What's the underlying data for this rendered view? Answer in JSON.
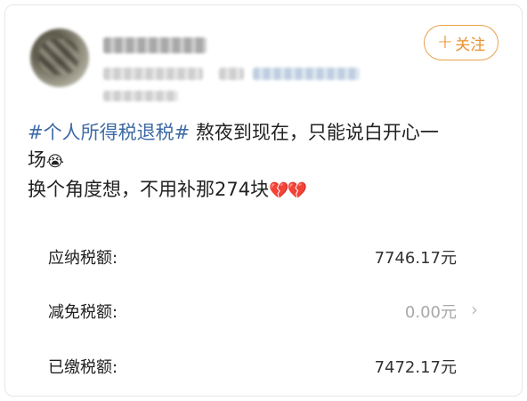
{
  "post": {
    "follow_label": "关注",
    "topic": "#个人所得税退税#",
    "text_line1": " 熬夜到现在，只能说白开心一",
    "text_line2": "场",
    "text_line3": "换个角度想，不用补那274块",
    "crying_emoji": "😭",
    "broken_hearts": "💔💔"
  },
  "tax": {
    "rows": [
      {
        "label": "应纳税额:",
        "value": "7746.17元"
      },
      {
        "label": "减免税额:",
        "value": "0.00元"
      },
      {
        "label": "已缴税额:",
        "value": "7472.17元"
      }
    ]
  },
  "colors": {
    "topic": "#3d6aa6",
    "follow_border": "#e8a24a",
    "muted_value": "#a8a8a8"
  },
  "icons": {
    "plus": "plus-icon",
    "chevron": "chevron-right-icon"
  }
}
